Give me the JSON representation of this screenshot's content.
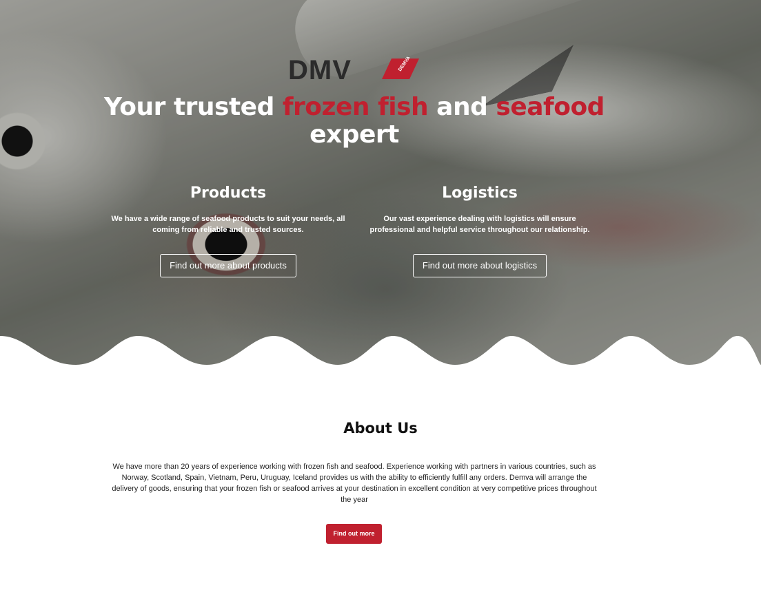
{
  "brand": {
    "logo_text": "DMV",
    "logo_tag": "DEMVA",
    "accent_color": "#c0202f",
    "logo_color": "#2b2b2b"
  },
  "hero": {
    "headline_part1": "Your trusted ",
    "headline_red1": "frozen fish",
    "headline_part2": " and ",
    "headline_red2": "seafood",
    "headline_part3": "expert",
    "background_image": "close-up of frozen mackerel fish"
  },
  "products": {
    "title": "Products",
    "description": "We have a wide range of seafood products to suit your needs, all coming from reliable and trusted sources.",
    "button_label": "Find out more about products"
  },
  "logistics": {
    "title": "Logistics",
    "description": "Our vast experience dealing with logistics will ensure professional and helpful service throughout our relationship.",
    "button_label": "Find out more about logistics"
  },
  "about": {
    "title": "About Us",
    "text": "We have more than 20 years of experience working with frozen fish and seafood. Experience working with partners in various countries, such as Norway, Scotland, Spain, Vietnam, Peru, Uruguay, Iceland provides us with the ability to efficiently fulfill any orders. Demva will arrange the delivery of goods, ensuring that your frozen fish or seafood arrives at your destination in excellent condition at very competitive prices throughout the year",
    "button_label": "Find out more"
  }
}
